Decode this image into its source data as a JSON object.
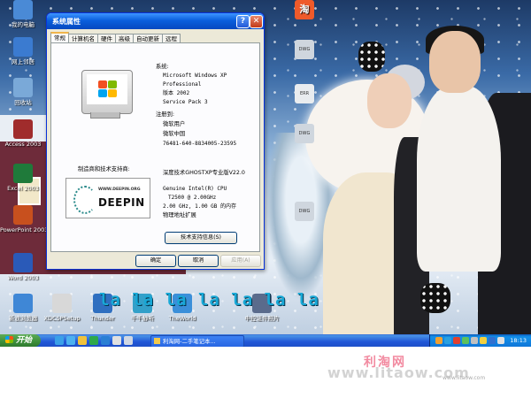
{
  "window": {
    "title": "系统属性",
    "help_glyph": "?",
    "close_glyph": "✕",
    "tabs": [
      "常规",
      "计算机名",
      "硬件",
      "高级",
      "自动更新",
      "远程"
    ],
    "active_tab": "常规",
    "system_heading": "系统:",
    "system_lines": [
      "Microsoft Windows XP",
      "Professional",
      "版本 2002",
      "Service Pack 3"
    ],
    "registered_heading": "注册到:",
    "registered_lines": [
      "微软用户",
      "微软中国",
      "76481-640-8834005-23595"
    ],
    "manufacturer_label": "制造商和技术支持商:",
    "manufacturer_name": "深度技术GHOSTXP专业版V22.0",
    "hardware_lines": [
      "Genuine Intel(R) CPU",
      "T2500  @ 2.00GHz",
      "2.00 GHz, 1.00 GB 的内存",
      "物理地址扩展"
    ],
    "deepin_logo_small": "WWW.DEEPIN.ORG",
    "deepin_logo_big": "DEEPIN",
    "support_button": "技术支持信息(S)",
    "ok_button": "确定",
    "cancel_button": "取消",
    "apply_button": "应用(A)"
  },
  "desktop_icons": [
    {
      "label": "我的电脑",
      "color": "#4a8ad6"
    },
    {
      "label": "网上邻居",
      "color": "#3b7bd0"
    },
    {
      "label": "回收站",
      "color": "#7aa9d8"
    },
    {
      "label": "Access 2003",
      "color": "#a02c2c"
    },
    {
      "label": "Excel 2003",
      "color": "#1f7a3a"
    },
    {
      "label": "PowerPoint 2003",
      "color": "#c8501e"
    },
    {
      "label": "Word 2003",
      "color": "#2a5ab8"
    },
    {
      "label": "新浪浏览器",
      "color": "#3f87d6"
    },
    {
      "label": "XDCSPSetup",
      "color": "#d8d8d8"
    },
    {
      "label": "Thunder",
      "color": "#2f6fc0"
    },
    {
      "label": "千千静听",
      "color": "#33a0c9"
    },
    {
      "label": "TheWorld",
      "color": "#3b8fd9"
    },
    {
      "label": "中控证件照片",
      "color": "#5a6b8c"
    }
  ],
  "right_icons": [
    {
      "label": "淘",
      "color": "#ef5a2a"
    },
    {
      "label": "DWG",
      "color": "#cfd6de"
    },
    {
      "label": "DWG",
      "color": "#cfd6de"
    },
    {
      "label": "ERR",
      "color": "#e9ecef"
    },
    {
      "label": "DWG",
      "color": "#cfd6de"
    }
  ],
  "lyrics": "la la la la la la la",
  "taskbar": {
    "start_label": "开始",
    "task_label": "利淘网-二手笔记本...",
    "clock": "18:13",
    "quicklaunch_colors": [
      "#3aa0e8",
      "#4cb1ef",
      "#f0c23b",
      "#2fa84a",
      "#2a7fd4"
    ],
    "tray_colors": [
      "#f0a030",
      "#2aa0e0",
      "#e04030",
      "#5cc05c",
      "#c0c0c0",
      "#f0d040",
      "#3070d0",
      "#e0e0e0"
    ]
  },
  "watermark": {
    "cn": "利淘网",
    "url": "www.litaow.com",
    "url_small": "www.litaow.com"
  }
}
